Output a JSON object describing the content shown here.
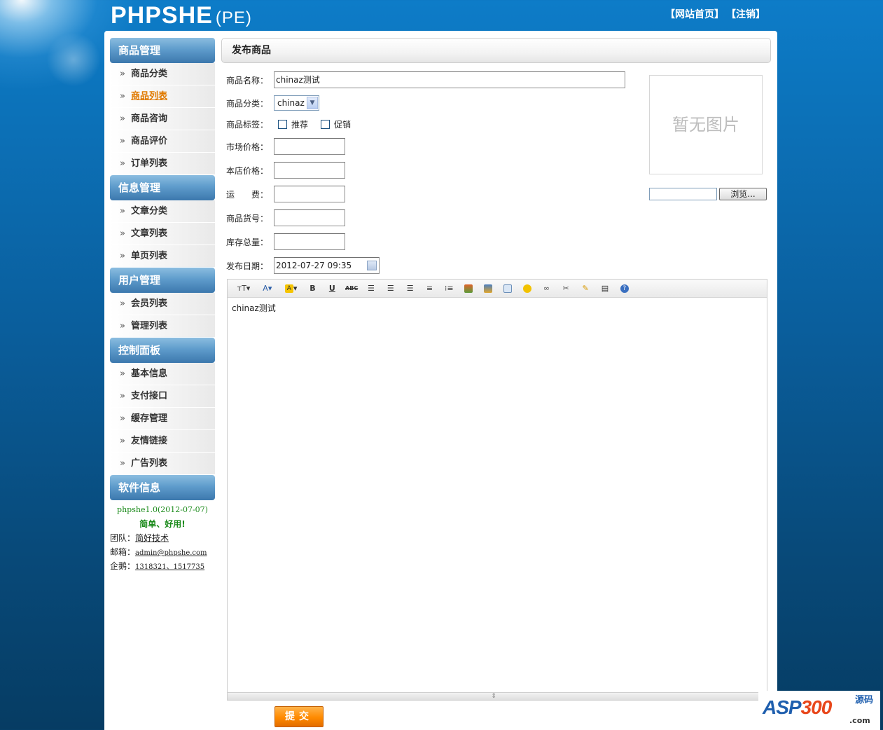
{
  "header": {
    "logo": "PHPSHE",
    "logo_sub": "(PE)",
    "links": [
      "【网站首页】",
      "【注销】"
    ]
  },
  "sidebar": {
    "sections": [
      {
        "title": "商品管理",
        "items": [
          "商品分类",
          "商品列表",
          "商品咨询",
          "商品评价",
          "订单列表"
        ]
      },
      {
        "title": "信息管理",
        "items": [
          "文章分类",
          "文章列表",
          "单页列表"
        ]
      },
      {
        "title": "用户管理",
        "items": [
          "会员列表",
          "管理列表"
        ]
      },
      {
        "title": "控制面板",
        "items": [
          "基本信息",
          "支付接口",
          "缓存管理",
          "友情链接",
          "广告列表"
        ]
      }
    ],
    "active_item": "商品列表",
    "arrow": "»",
    "software": {
      "title": "软件信息",
      "version": "phpshe1.0(2012-07-07)",
      "slogan": "简单、好用!",
      "team_label": "团队：",
      "team_value": "简好技术",
      "email_label": "邮箱：",
      "email_value": "admin@phpshe.com",
      "qq_label": "企鹅：",
      "qq_value": "1318321、1517735"
    }
  },
  "content": {
    "panel_title": "发布商品",
    "form": {
      "name_label": "商品名称：",
      "name_value": "chinaz测试",
      "category_label": "商品分类：",
      "category_value": "chinaz",
      "tags_label": "商品标签：",
      "tag_recommend": "推荐",
      "tag_promo": "促销",
      "market_price_label": "市场价格：",
      "market_price_value": "",
      "shop_price_label": "本店价格：",
      "shop_price_value": "",
      "shipping_label": "运　　费：",
      "shipping_value": "",
      "sku_label": "商品货号：",
      "sku_value": "",
      "stock_label": "库存总量：",
      "stock_value": "",
      "date_label": "发布日期：",
      "date_value": "2012-07-27 09:35"
    },
    "image": {
      "placeholder": "暂无图片",
      "browse_label": "浏览..."
    },
    "editor": {
      "toolbar_icons": [
        "font-size-icon",
        "font-color-icon",
        "highlight-icon",
        "bold-icon",
        "underline-icon",
        "strikethrough-icon",
        "align-left-icon",
        "align-center-icon",
        "align-right-icon",
        "ordered-list-icon",
        "unordered-list-icon",
        "image-icon",
        "multi-image-icon",
        "flash-icon",
        "emoticon-icon",
        "link-icon",
        "unlink-icon",
        "clear-format-icon",
        "source-icon",
        "help-icon"
      ],
      "body_text": "chinaz测试"
    },
    "submit_label": "提交"
  },
  "watermark": {
    "text_a": "ASP",
    "text_b": "300",
    "side": "源码",
    "com": ".com"
  }
}
